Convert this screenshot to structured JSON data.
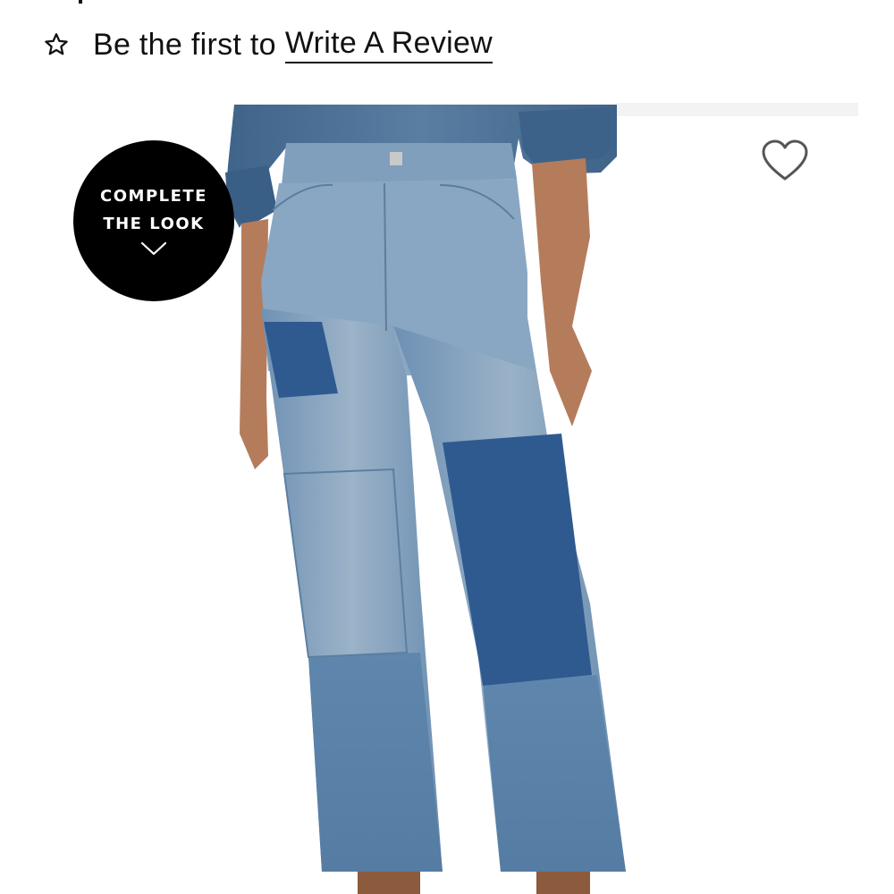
{
  "reviews": {
    "prompt": "Be the first to",
    "link_label": "Write A Review",
    "star_icon": "star-outline-icon"
  },
  "badge": {
    "line1": "COMPLETE",
    "line2": "THE LOOK",
    "icon": "chevron-down-icon"
  },
  "wishlist": {
    "icon": "heart-outline-icon"
  },
  "image": {
    "subject": "product-photo-jeans",
    "colors": {
      "shirt": "#45698f",
      "jean_light": "#8ba7c0",
      "jean_mid": "#5f86ac",
      "patch": "#2f5a90",
      "skin": "#b57c5c"
    }
  }
}
